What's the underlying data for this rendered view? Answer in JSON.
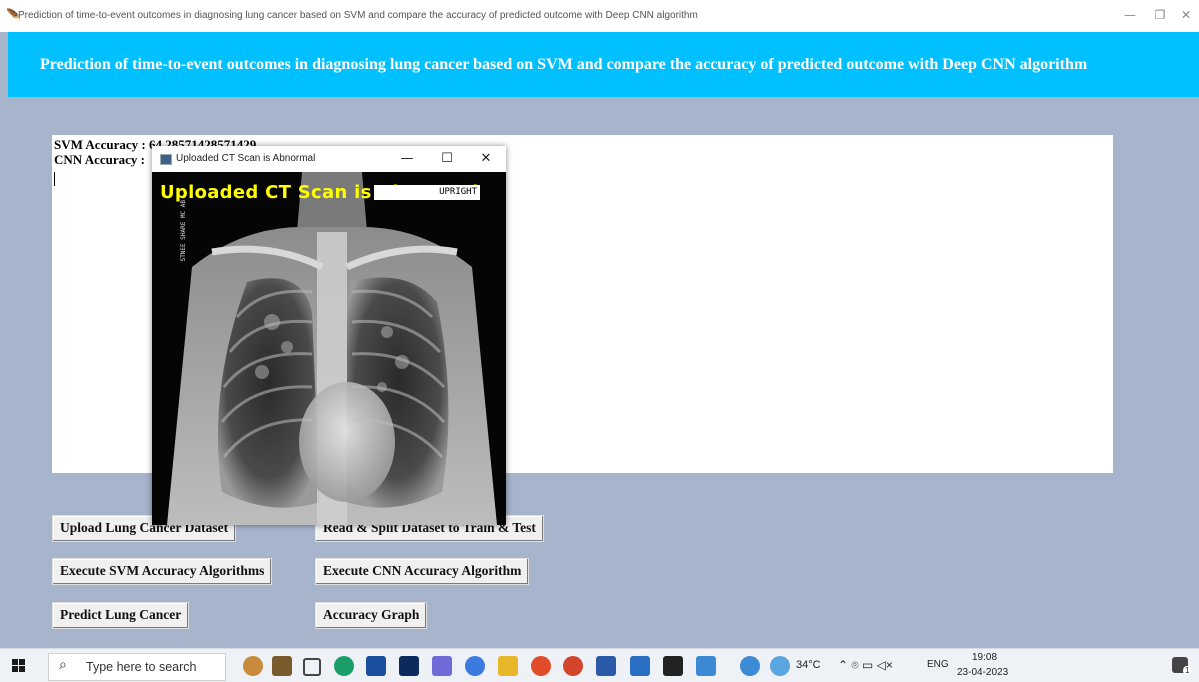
{
  "window": {
    "title": "Prediction of time-to-event outcomes in diagnosing lung cancer based on  SVM and compare the accuracy of predicted outcome with Deep CNN algorithm",
    "minimize": "—",
    "restore": "❐",
    "close": "✕"
  },
  "banner": {
    "title": "Prediction of time-to-event outcomes in diagnosing lung cancer based on  SVM and compare the accuracy of predicted outcome with Deep CNN algorithm",
    "color": "#00c0ff"
  },
  "output": {
    "svm_accuracy": "SVM Accuracy : 64.28571428571429",
    "cnn_accuracy": "CNN Accuracy :"
  },
  "buttons": {
    "upload": "Upload Lung Cancer Dataset",
    "read_split": "Read & Split Dataset to Train & Test",
    "svm": "Execute SVM Accuracy Algorithms",
    "cnn": "Execute CNN Accuracy Algorithm",
    "predict": "Predict Lung Cancer",
    "graph": "Accuracy Graph"
  },
  "popup": {
    "title": "Uploaded CT Scan is Abnormal",
    "overlay": "Uploaded CT Scan is Abnormal",
    "label": "UPRIGHT",
    "side_text": "STNEE SHARE  MC  AB",
    "minimize": "—",
    "maximize": "☐",
    "close": "✕"
  },
  "taskbar": {
    "search_placeholder": "Type here to search",
    "weather": "34°C",
    "language": "ENG",
    "time": "19:08",
    "date": "23-04-2023",
    "notification_count": "1",
    "icons": [
      "windows-icon",
      "search-icon",
      "news-widget-icon",
      "library-icon",
      "task-view-icon",
      "edge-icon",
      "mail-icon",
      "dropbox-icon",
      "visual-studio-icon",
      "app-icon",
      "file-explorer-icon",
      "chrome-icon",
      "powerpoint-icon",
      "word-icon",
      "outlook-icon",
      "terminal-icon",
      "photos-icon",
      "help-icon",
      "weather-icon",
      "notification-icon"
    ]
  }
}
